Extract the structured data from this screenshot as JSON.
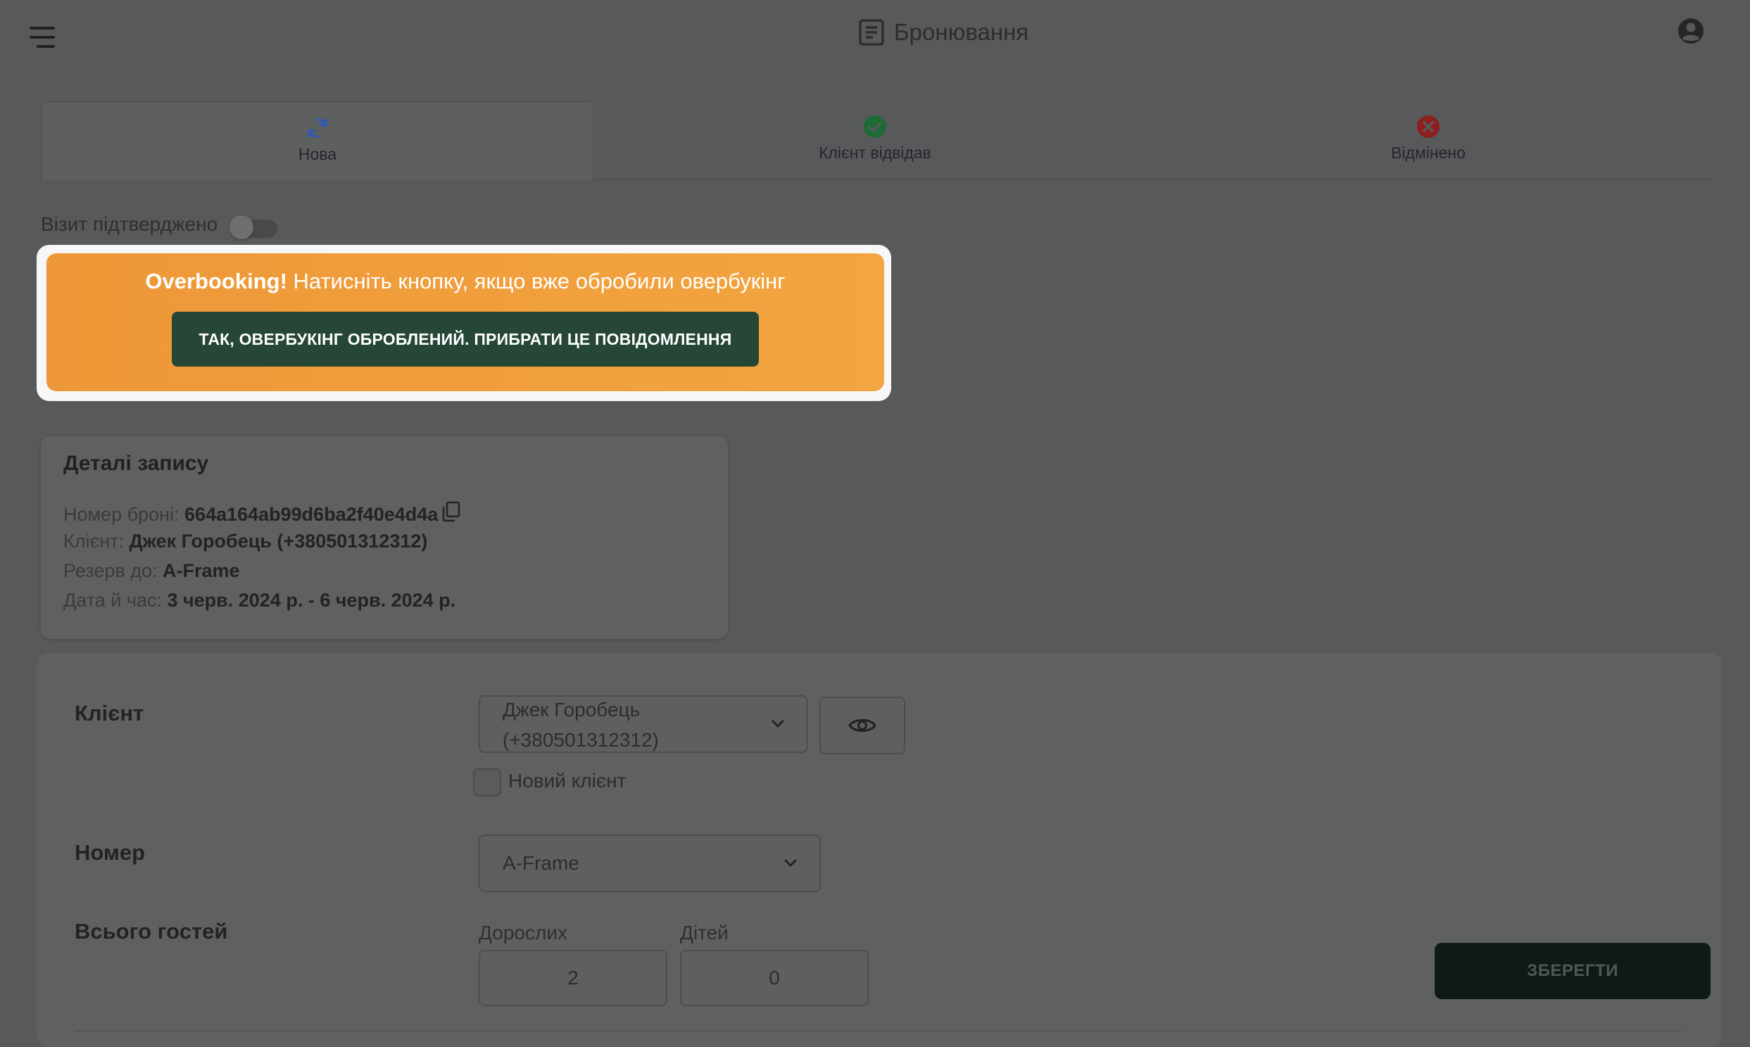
{
  "header": {
    "title": "Бронювання",
    "menu_icon": "hamburger-menu-icon",
    "title_icon": "document-icon",
    "account_icon": "account-circle-icon"
  },
  "tabs": [
    {
      "label": "Нова",
      "icon": "refresh-icon",
      "color": "#2f5bb0",
      "active": true
    },
    {
      "label": "Клієнт відвідав",
      "icon": "check-circle-icon",
      "color": "#1e6b35",
      "active": false
    },
    {
      "label": "Відмінено",
      "icon": "cancel-circle-icon",
      "color": "#8f1e1e",
      "active": false
    }
  ],
  "visit_confirmed": {
    "label": "Візит підтверджено",
    "checked": false
  },
  "overbooking": {
    "bold": "Overbooking!",
    "text": " Натисніть кнопку, якщо вже обробили овербукінг",
    "button": "ТАК, ОВЕРБУКІНГ ОБРОБЛЕНИЙ. ПРИБРАТИ ЦЕ ПОВІДОМЛЕННЯ",
    "background": "#f09d3c",
    "button_color": "#264636"
  },
  "details": {
    "title": "Деталі запису",
    "rows": [
      {
        "key": "Номер броні: ",
        "value": "664a164ab99d6ba2f40e4d4a"
      },
      {
        "key": "Клієнт: ",
        "value": "Джек Горобець (+380501312312)"
      },
      {
        "key": "Резерв до: ",
        "value": "A-Frame"
      },
      {
        "key": "Дата й час: ",
        "value": "3 черв. 2024 р. - 6 черв. 2024 р."
      }
    ],
    "copy_icon": "copy-icon"
  },
  "form": {
    "client": {
      "label": "Клієнт",
      "value_line1": "Джек Горобець",
      "value_line2": "(+380501312312)",
      "view_icon": "eye-icon",
      "new_client_label": "Новий клієнт",
      "new_client_checked": false
    },
    "room": {
      "label": "Номер",
      "value": "A-Frame"
    },
    "guests": {
      "label": "Всього гостей",
      "adults_label": "Дорослих",
      "adults": "2",
      "children_label": "Дітей",
      "children": "0"
    }
  },
  "save_button": "ЗБЕРЕГТИ"
}
